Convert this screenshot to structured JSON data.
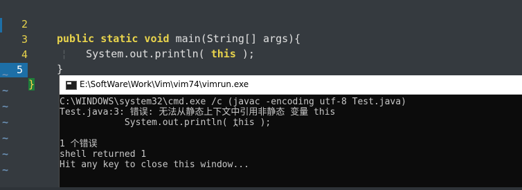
{
  "editor": {
    "lines": [
      {
        "num": "2",
        "tokens": [
          {
            "t": "public static void",
            "c": "kw"
          },
          {
            "t": " main(String[] args){",
            "c": "fn"
          }
        ]
      },
      {
        "num": "3",
        "tokens": [
          {
            "t": "System.out.println( ",
            "c": "fn"
          },
          {
            "t": "this",
            "c": "kw-this"
          },
          {
            "t": " );",
            "c": "fn"
          }
        ]
      },
      {
        "num": "4",
        "tokens": [
          {
            "t": "}",
            "c": "fn"
          }
        ]
      },
      {
        "num": "5",
        "tokens": [
          {
            "t": "}",
            "c": "brace"
          }
        ]
      }
    ],
    "tilde": "~",
    "active_line": "5"
  },
  "console": {
    "title": "E:\\SoftWare\\Work\\Vim\\vim74\\vimrun.exe",
    "lines": [
      "C:\\WINDOWS\\system32\\cmd.exe /c (javac -encoding utf-8 Test.java)",
      "Test.java:3: 错误: 无法从静态上下文中引用非静态 变量 this",
      "            System.out.println( this );",
      "                                ^",
      "1 个错误",
      "shell returned 1",
      "Hit any key to close this window..."
    ]
  },
  "colors": {
    "editor_bg": "#353a3f",
    "line_number": "#e9d44c",
    "keyword": "#e9d44c",
    "active_line_bg": "#1d6fa7",
    "console_bg": "#0c0c0c",
    "console_fg": "#c8c8c8"
  }
}
